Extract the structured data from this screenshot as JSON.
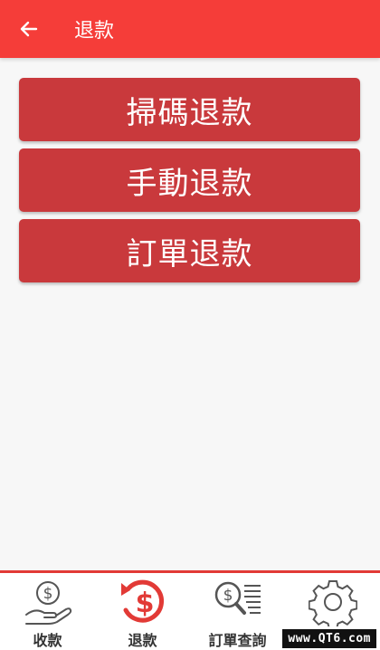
{
  "header": {
    "title": "退款",
    "back_icon": "arrow-left-icon",
    "background": "#f53d39"
  },
  "actions": [
    {
      "label": "掃碼退款"
    },
    {
      "label": "手動退款"
    },
    {
      "label": "訂單退款"
    }
  ],
  "bottom_nav": {
    "items": [
      {
        "label": "收款",
        "icon": "hand-dollar-icon"
      },
      {
        "label": "退款",
        "icon": "refund-dollar-icon",
        "active": true
      },
      {
        "label": "訂單查詢",
        "icon": "search-receipt-icon"
      },
      {
        "label": "",
        "icon": "gear-icon"
      }
    ],
    "accent": "#e23a36"
  },
  "watermark": "www.QT6.com"
}
